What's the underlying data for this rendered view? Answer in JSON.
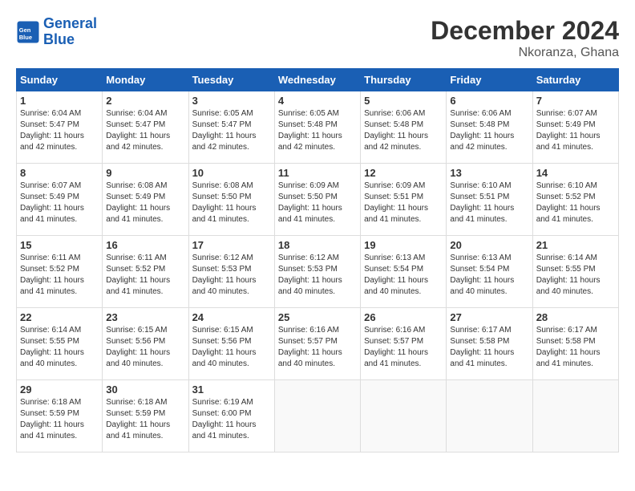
{
  "logo": {
    "line1": "General",
    "line2": "Blue"
  },
  "title": "December 2024",
  "location": "Nkoranza, Ghana",
  "days_header": [
    "Sunday",
    "Monday",
    "Tuesday",
    "Wednesday",
    "Thursday",
    "Friday",
    "Saturday"
  ],
  "weeks": [
    [
      {
        "day": "1",
        "sunrise": "6:04 AM",
        "sunset": "5:47 PM",
        "daylight": "11 hours and 42 minutes."
      },
      {
        "day": "2",
        "sunrise": "6:04 AM",
        "sunset": "5:47 PM",
        "daylight": "11 hours and 42 minutes."
      },
      {
        "day": "3",
        "sunrise": "6:05 AM",
        "sunset": "5:47 PM",
        "daylight": "11 hours and 42 minutes."
      },
      {
        "day": "4",
        "sunrise": "6:05 AM",
        "sunset": "5:48 PM",
        "daylight": "11 hours and 42 minutes."
      },
      {
        "day": "5",
        "sunrise": "6:06 AM",
        "sunset": "5:48 PM",
        "daylight": "11 hours and 42 minutes."
      },
      {
        "day": "6",
        "sunrise": "6:06 AM",
        "sunset": "5:48 PM",
        "daylight": "11 hours and 42 minutes."
      },
      {
        "day": "7",
        "sunrise": "6:07 AM",
        "sunset": "5:49 PM",
        "daylight": "11 hours and 41 minutes."
      }
    ],
    [
      {
        "day": "8",
        "sunrise": "6:07 AM",
        "sunset": "5:49 PM",
        "daylight": "11 hours and 41 minutes."
      },
      {
        "day": "9",
        "sunrise": "6:08 AM",
        "sunset": "5:49 PM",
        "daylight": "11 hours and 41 minutes."
      },
      {
        "day": "10",
        "sunrise": "6:08 AM",
        "sunset": "5:50 PM",
        "daylight": "11 hours and 41 minutes."
      },
      {
        "day": "11",
        "sunrise": "6:09 AM",
        "sunset": "5:50 PM",
        "daylight": "11 hours and 41 minutes."
      },
      {
        "day": "12",
        "sunrise": "6:09 AM",
        "sunset": "5:51 PM",
        "daylight": "11 hours and 41 minutes."
      },
      {
        "day": "13",
        "sunrise": "6:10 AM",
        "sunset": "5:51 PM",
        "daylight": "11 hours and 41 minutes."
      },
      {
        "day": "14",
        "sunrise": "6:10 AM",
        "sunset": "5:52 PM",
        "daylight": "11 hours and 41 minutes."
      }
    ],
    [
      {
        "day": "15",
        "sunrise": "6:11 AM",
        "sunset": "5:52 PM",
        "daylight": "11 hours and 41 minutes."
      },
      {
        "day": "16",
        "sunrise": "6:11 AM",
        "sunset": "5:52 PM",
        "daylight": "11 hours and 41 minutes."
      },
      {
        "day": "17",
        "sunrise": "6:12 AM",
        "sunset": "5:53 PM",
        "daylight": "11 hours and 40 minutes."
      },
      {
        "day": "18",
        "sunrise": "6:12 AM",
        "sunset": "5:53 PM",
        "daylight": "11 hours and 40 minutes."
      },
      {
        "day": "19",
        "sunrise": "6:13 AM",
        "sunset": "5:54 PM",
        "daylight": "11 hours and 40 minutes."
      },
      {
        "day": "20",
        "sunrise": "6:13 AM",
        "sunset": "5:54 PM",
        "daylight": "11 hours and 40 minutes."
      },
      {
        "day": "21",
        "sunrise": "6:14 AM",
        "sunset": "5:55 PM",
        "daylight": "11 hours and 40 minutes."
      }
    ],
    [
      {
        "day": "22",
        "sunrise": "6:14 AM",
        "sunset": "5:55 PM",
        "daylight": "11 hours and 40 minutes."
      },
      {
        "day": "23",
        "sunrise": "6:15 AM",
        "sunset": "5:56 PM",
        "daylight": "11 hours and 40 minutes."
      },
      {
        "day": "24",
        "sunrise": "6:15 AM",
        "sunset": "5:56 PM",
        "daylight": "11 hours and 40 minutes."
      },
      {
        "day": "25",
        "sunrise": "6:16 AM",
        "sunset": "5:57 PM",
        "daylight": "11 hours and 40 minutes."
      },
      {
        "day": "26",
        "sunrise": "6:16 AM",
        "sunset": "5:57 PM",
        "daylight": "11 hours and 41 minutes."
      },
      {
        "day": "27",
        "sunrise": "6:17 AM",
        "sunset": "5:58 PM",
        "daylight": "11 hours and 41 minutes."
      },
      {
        "day": "28",
        "sunrise": "6:17 AM",
        "sunset": "5:58 PM",
        "daylight": "11 hours and 41 minutes."
      }
    ],
    [
      {
        "day": "29",
        "sunrise": "6:18 AM",
        "sunset": "5:59 PM",
        "daylight": "11 hours and 41 minutes."
      },
      {
        "day": "30",
        "sunrise": "6:18 AM",
        "sunset": "5:59 PM",
        "daylight": "11 hours and 41 minutes."
      },
      {
        "day": "31",
        "sunrise": "6:19 AM",
        "sunset": "6:00 PM",
        "daylight": "11 hours and 41 minutes."
      },
      null,
      null,
      null,
      null
    ]
  ]
}
